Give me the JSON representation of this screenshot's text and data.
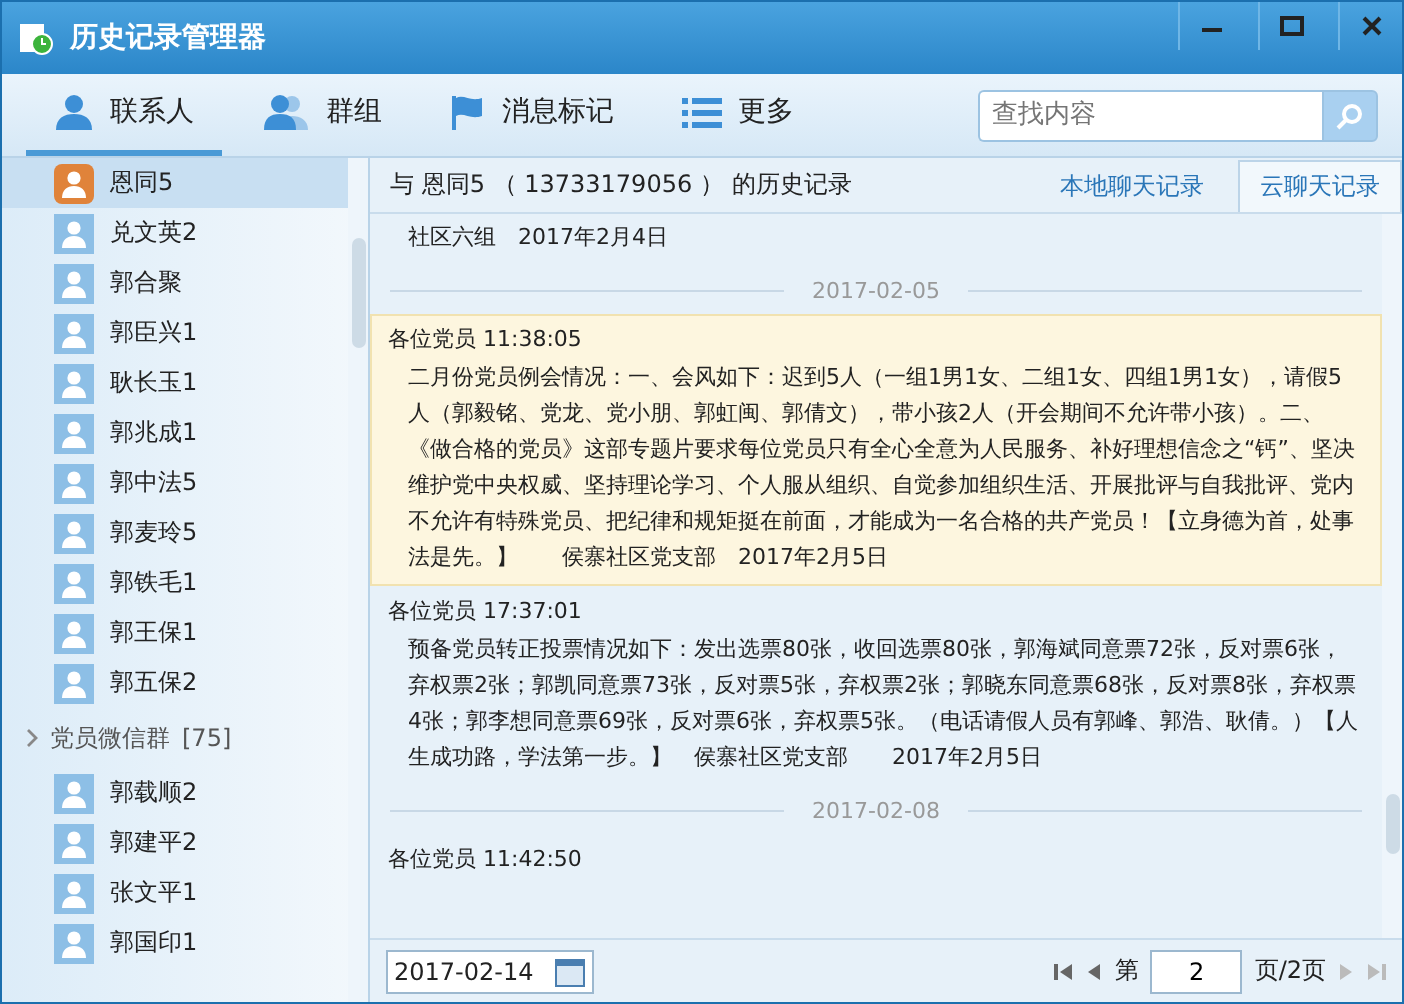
{
  "window": {
    "title": "历史记录管理器"
  },
  "toolbar": {
    "tabs": [
      {
        "label": "联系人",
        "selected": true
      },
      {
        "label": "群组",
        "selected": false
      },
      {
        "label": "消息标记",
        "selected": false
      },
      {
        "label": "更多",
        "selected": false
      }
    ],
    "search": {
      "placeholder": "查找内容"
    }
  },
  "sidebar": {
    "items": [
      {
        "kind": "contact",
        "name": "恩同5",
        "photo": true,
        "selected": true
      },
      {
        "kind": "contact",
        "name": "兑文英2",
        "selected": false
      },
      {
        "kind": "contact",
        "name": "郭合聚",
        "selected": false
      },
      {
        "kind": "contact",
        "name": "郭臣兴1",
        "selected": false
      },
      {
        "kind": "contact",
        "name": "耿长玉1",
        "selected": false
      },
      {
        "kind": "contact",
        "name": "郭兆成1",
        "selected": false
      },
      {
        "kind": "contact",
        "name": "郭中法5",
        "selected": false
      },
      {
        "kind": "contact",
        "name": "郭麦玲5",
        "selected": false
      },
      {
        "kind": "contact",
        "name": "郭铁毛1",
        "selected": false
      },
      {
        "kind": "contact",
        "name": "郭王保1",
        "selected": false
      },
      {
        "kind": "contact",
        "name": "郭五保2",
        "selected": false
      },
      {
        "kind": "group",
        "name": "党员微信群",
        "count": "[75]",
        "expanded": false
      },
      {
        "kind": "contact",
        "name": "郭载顺2",
        "selected": false
      },
      {
        "kind": "contact",
        "name": "郭建平2",
        "selected": false
      },
      {
        "kind": "contact",
        "name": "张文平1",
        "selected": false
      },
      {
        "kind": "contact",
        "name": "郭国印1",
        "selected": false
      }
    ]
  },
  "history": {
    "prefix": "与",
    "contact": "恩同5",
    "phone": "（ 13733179056 ）",
    "suffix": "的历史记录",
    "tabs": [
      {
        "label": "本地聊天记录",
        "selected": false
      },
      {
        "label": "云聊天记录",
        "selected": true
      }
    ],
    "messages": [
      {
        "kind": "message",
        "text": "社区六组　2017年2月4日",
        "highlighted": false
      },
      {
        "kind": "date",
        "text": "2017-02-05"
      },
      {
        "kind": "message",
        "sender": "各位党员",
        "time": "11:38:05",
        "highlighted": true,
        "text": "二月份党员例会情况：一、会风如下：迟到5人（一组1男1女、二组1女、四组1男1女），请假5人（郭毅铭、党龙、党小朋、郭虹闽、郭倩文），带小孩2人（开会期间不允许带小孩）。二、《做合格的党员》这部专题片要求每位党员只有全心全意为人民服务、补好理想信念之“钙”、坚决维护党中央权威、坚持理论学习、个人服从组织、自觉参加组织生活、开展批评与自我批评、党内不允许有特殊党员、把纪律和规矩挺在前面，才能成为一名合格的共产党员！【立身德为首，处事法是先。】　　侯寨社区党支部　2017年2月5日"
      },
      {
        "kind": "message",
        "sender": "各位党员",
        "time": "17:37:01",
        "highlighted": false,
        "text": "预备党员转正投票情况如下：发出选票80张，收回选票80张，郭海斌同意票72张，反对票6张，弃权票2张；郭凯同意票73张，反对票5张，弃权票2张；郭晓东同意票68张，反对票8张，弃权票4张；郭李想同意票69张，反对票6张，弃权票5张。（电话请假人员有郭峰、郭浩、耿倩。）【人生成功路，学法第一步。】　侯寨社区党支部　　2017年2月5日"
      },
      {
        "kind": "date",
        "text": "2017-02-08"
      },
      {
        "kind": "message",
        "sender": "各位党员",
        "time": "11:42:50",
        "highlighted": false
      }
    ]
  },
  "footer": {
    "date": "2017-02-14",
    "page_label": "第",
    "page": "2",
    "page_total": "页/2页"
  }
}
